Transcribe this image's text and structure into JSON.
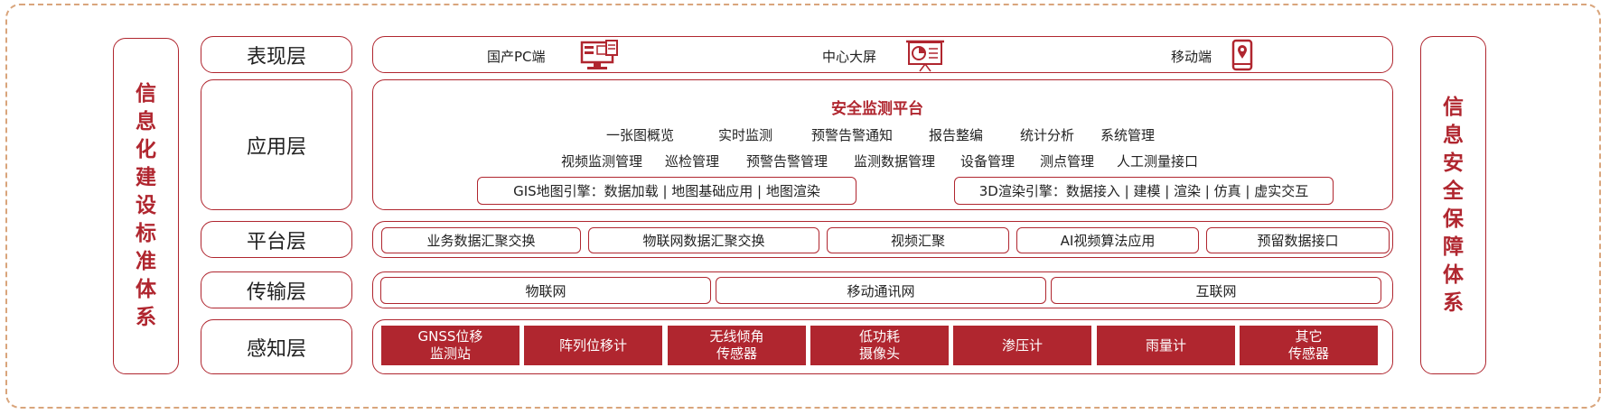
{
  "left_pillar": [
    "信",
    "息",
    "化",
    "建",
    "设",
    "标",
    "准",
    "体",
    "系"
  ],
  "right_pillar": [
    "信",
    "息",
    "安",
    "全",
    "保",
    "障",
    "体",
    "系"
  ],
  "layers": {
    "presentation": {
      "label": "表现层",
      "items": [
        {
          "text": "国产PC端",
          "icon": "desktop-pc-icon"
        },
        {
          "text": "中心大屏",
          "icon": "presentation-screen-icon"
        },
        {
          "text": "移动端",
          "icon": "mobile-phone-icon"
        }
      ]
    },
    "application": {
      "label": "应用层",
      "title": "安全监测平台",
      "row1": [
        "一张图概览",
        "实时监测",
        "预警告警通知",
        "报告整编",
        "统计分析",
        "系统管理"
      ],
      "row2": [
        "视频监测管理",
        "巡检管理",
        "预警告警管理",
        "监测数据管理",
        "设备管理",
        "测点管理",
        "人工测量接口"
      ],
      "engines": [
        "GIS地图引擎：数据加载 | 地图基础应用 | 地图渲染",
        "3D渲染引擎：数据接入 | 建模 | 渲染 | 仿真 | 虚实交互"
      ]
    },
    "platform": {
      "label": "平台层",
      "items": [
        "业务数据汇聚交换",
        "物联网数据汇聚交换",
        "视频汇聚",
        "AI视频算法应用",
        "预留数据接口"
      ]
    },
    "transport": {
      "label": "传输层",
      "items": [
        "物联网",
        "移动通讯网",
        "互联网"
      ]
    },
    "perception": {
      "label": "感知层",
      "items": [
        "GNSS位移\n监测站",
        "阵列位移计",
        "无线倾角\n传感器",
        "低功耗\n摄像头",
        "渗压计",
        "雨量计",
        "其它\n传感器"
      ]
    }
  },
  "colors": {
    "accent": "#b0262f",
    "dashed_border": "#d9a57c"
  }
}
